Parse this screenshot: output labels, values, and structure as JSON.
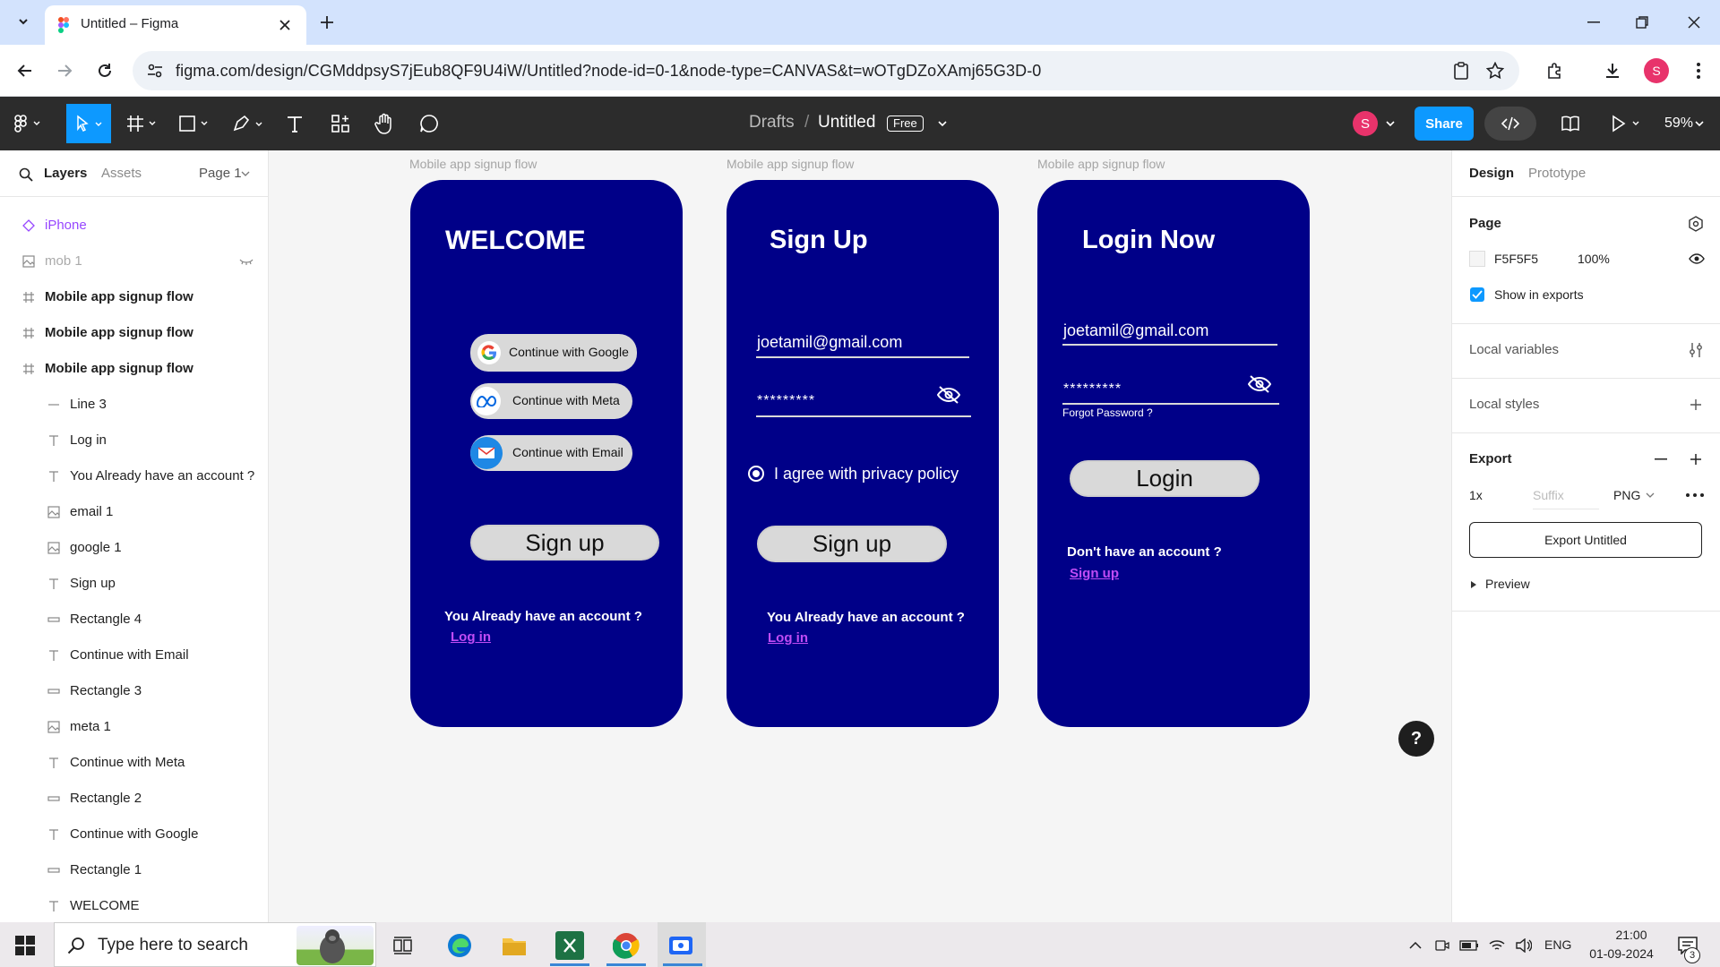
{
  "browser": {
    "tab_title": "Untitled – Figma",
    "url": "figma.com/design/CGMddpsyS7jEub8QF9U4iW/Untitled?node-id=0-1&node-type=CANVAS&t=wOTgDZoXAmj65G3D-0",
    "profile_initial": "S"
  },
  "toolbar": {
    "breadcrumb_parent": "Drafts",
    "separator": "/",
    "file_name": "Untitled",
    "plan_badge": "Free",
    "avatar_initial": "S",
    "share_label": "Share",
    "zoom": "59%"
  },
  "left_panel": {
    "tabs": [
      "Layers",
      "Assets"
    ],
    "page_selector": "Page 1",
    "layers": [
      {
        "name": "iPhone",
        "icon": "component-icon"
      },
      {
        "name": "mob 1",
        "icon": "image-icon"
      },
      {
        "name": "Mobile app signup flow",
        "icon": "frame-icon"
      },
      {
        "name": "Mobile app signup flow",
        "icon": "frame-icon"
      },
      {
        "name": "Mobile app signup flow",
        "icon": "frame-icon"
      },
      {
        "name": "Line 3",
        "icon": "line-icon"
      },
      {
        "name": "Log in",
        "icon": "text-icon"
      },
      {
        "name": "You Already have an account ?",
        "icon": "text-icon"
      },
      {
        "name": "email 1",
        "icon": "image-icon"
      },
      {
        "name": "google 1",
        "icon": "image-icon"
      },
      {
        "name": "Sign up",
        "icon": "text-icon"
      },
      {
        "name": "Rectangle 4",
        "icon": "rectangle-icon"
      },
      {
        "name": "Continue with Email",
        "icon": "text-icon"
      },
      {
        "name": "Rectangle 3",
        "icon": "rectangle-icon"
      },
      {
        "name": "meta 1",
        "icon": "image-icon"
      },
      {
        "name": "Continue with Meta",
        "icon": "text-icon"
      },
      {
        "name": "Rectangle 2",
        "icon": "rectangle-icon"
      },
      {
        "name": "Continue with Google",
        "icon": "text-icon"
      },
      {
        "name": "Rectangle 1",
        "icon": "rectangle-icon"
      },
      {
        "name": "WELCOME",
        "icon": "text-icon"
      }
    ]
  },
  "canvas": {
    "frame_label": "Mobile app signup flow",
    "welcome": {
      "title": "WELCOME",
      "google": "Continue with Google",
      "meta": "Continue with Meta",
      "email": "Continue with Email",
      "signup": "Sign up",
      "account_q": "You Already have an account ?",
      "login_link": "Log in"
    },
    "signup": {
      "title": "Sign Up",
      "email": "joetamil@gmail.com",
      "password": "*********",
      "agree": "I agree with privacy policy",
      "signup": "Sign up",
      "account_q": "You Already have an account ?",
      "login_link": "Log in"
    },
    "login": {
      "title": "Login Now",
      "email": "joetamil@gmail.com",
      "password": "*********",
      "forgot": "Forgot Password ?",
      "login": "Login",
      "account_q": "Don't have an account ?",
      "signup_link": "Sign up"
    }
  },
  "right_panel": {
    "tabs": [
      "Design",
      "Prototype"
    ],
    "page_heading": "Page",
    "bg_color": "F5F5F5",
    "bg_opacity": "100%",
    "show_in_exports": "Show in exports",
    "local_variables": "Local variables",
    "local_styles": "Local styles",
    "export_heading": "Export",
    "export_scale": "1x",
    "export_suffix_placeholder": "Suffix",
    "export_format": "PNG",
    "export_button": "Export Untitled",
    "preview": "Preview"
  },
  "taskbar": {
    "search_placeholder": "Type here to search",
    "language": "ENG",
    "time": "21:00",
    "date": "01-09-2024",
    "notif_count": "3"
  }
}
